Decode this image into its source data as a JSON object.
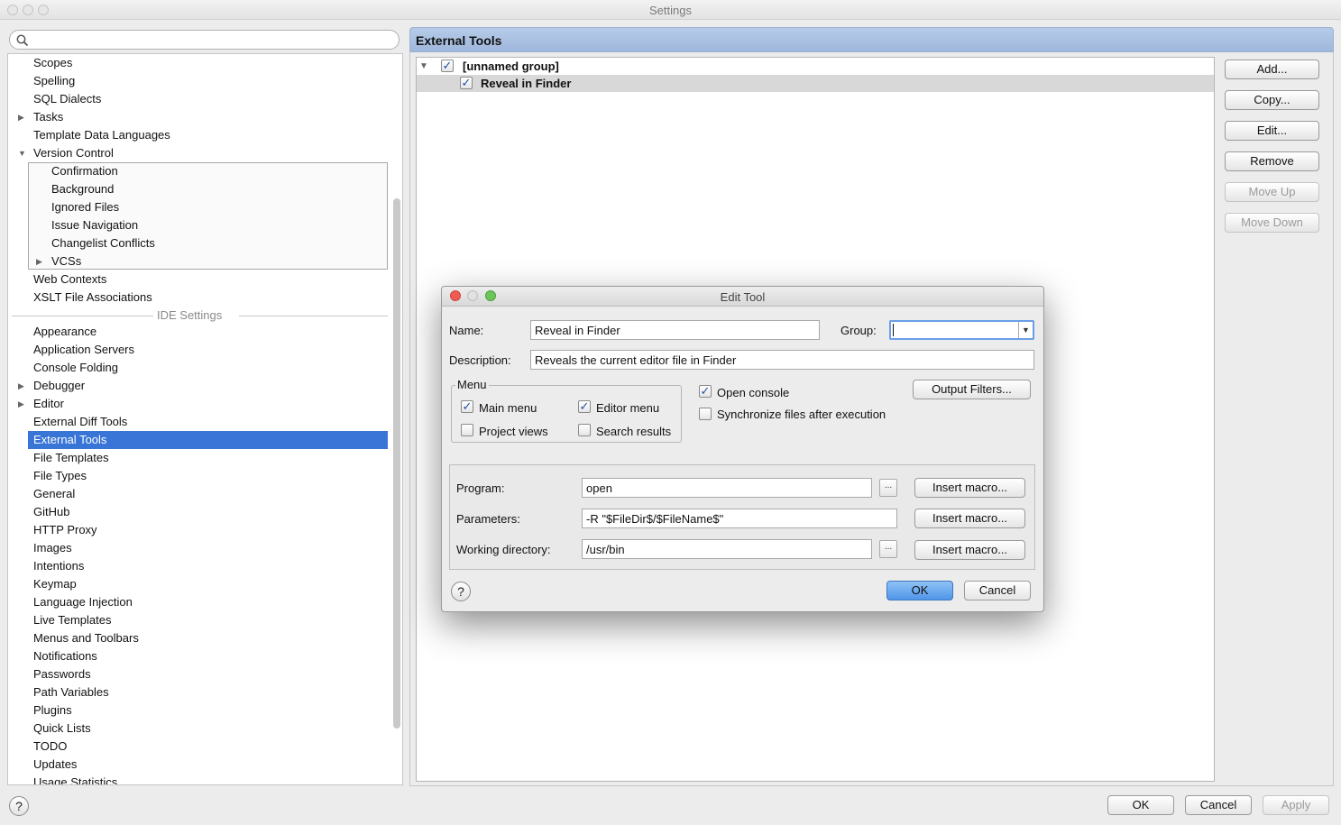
{
  "window": {
    "title": "Settings"
  },
  "search": {
    "placeholder": "",
    "value": ""
  },
  "sidebar": {
    "items": [
      {
        "label": "Scopes"
      },
      {
        "label": "Spelling"
      },
      {
        "label": "SQL Dialects"
      },
      {
        "label": "Tasks",
        "expandable": true
      },
      {
        "label": "Template Data Languages"
      },
      {
        "label": "Version Control",
        "expanded": true
      }
    ],
    "vcs_children": [
      {
        "label": "Confirmation"
      },
      {
        "label": "Background"
      },
      {
        "label": "Ignored Files"
      },
      {
        "label": "Issue Navigation"
      },
      {
        "label": "Changelist Conflicts"
      },
      {
        "label": "VCSs",
        "expandable": true
      }
    ],
    "after_vcs": [
      {
        "label": "Web Contexts"
      },
      {
        "label": "XSLT File Associations"
      }
    ],
    "ide_settings_label": "IDE Settings",
    "ide_items": [
      {
        "label": "Appearance"
      },
      {
        "label": "Application Servers"
      },
      {
        "label": "Console Folding"
      },
      {
        "label": "Debugger",
        "expandable": true
      },
      {
        "label": "Editor",
        "expandable": true
      },
      {
        "label": "External Diff Tools"
      },
      {
        "label": "External Tools",
        "selected": true
      },
      {
        "label": "File Templates"
      },
      {
        "label": "File Types"
      },
      {
        "label": "General"
      },
      {
        "label": "GitHub"
      },
      {
        "label": "HTTP Proxy"
      },
      {
        "label": "Images"
      },
      {
        "label": "Intentions"
      },
      {
        "label": "Keymap"
      },
      {
        "label": "Language Injection"
      },
      {
        "label": "Live Templates"
      },
      {
        "label": "Menus and Toolbars"
      },
      {
        "label": "Notifications"
      },
      {
        "label": "Passwords"
      },
      {
        "label": "Path Variables"
      },
      {
        "label": "Plugins"
      },
      {
        "label": "Quick Lists"
      },
      {
        "label": "TODO"
      },
      {
        "label": "Updates"
      },
      {
        "label": "Usage Statistics"
      }
    ]
  },
  "panel": {
    "title": "External Tools",
    "tree": [
      {
        "label": "[unnamed group]",
        "checked": true,
        "expanded": true
      },
      {
        "label": "Reveal in Finder",
        "checked": true,
        "selected": true
      }
    ],
    "buttons": {
      "add": "Add...",
      "copy": "Copy...",
      "edit": "Edit...",
      "remove": "Remove",
      "move_up": "Move Up",
      "move_down": "Move Down"
    }
  },
  "dialog": {
    "title": "Edit Tool",
    "name_label": "Name:",
    "name_value": "Reveal in Finder",
    "group_label": "Group:",
    "group_value": "",
    "description_label": "Description:",
    "description_value": "Reveals the current editor file in Finder",
    "menu_label": "Menu",
    "menu_options": {
      "main_menu": {
        "label": "Main menu",
        "checked": true
      },
      "editor_menu": {
        "label": "Editor menu",
        "checked": true
      },
      "project_views": {
        "label": "Project views",
        "checked": false
      },
      "search_results": {
        "label": "Search results",
        "checked": false
      }
    },
    "open_console": {
      "label": "Open console",
      "checked": true
    },
    "sync_files": {
      "label": "Synchronize files after execution",
      "checked": false
    },
    "output_filters": "Output Filters...",
    "program_label": "Program:",
    "program_value": "open",
    "parameters_label": "Parameters:",
    "parameters_value": "-R \"$FileDir$/$FileName$\"",
    "workdir_label": "Working directory:",
    "workdir_value": "/usr/bin",
    "insert_macro": "Insert macro...",
    "browse": "...",
    "ok": "OK",
    "cancel": "Cancel",
    "help": "?"
  },
  "footer": {
    "help": "?",
    "ok": "OK",
    "cancel": "Cancel",
    "apply": "Apply"
  }
}
